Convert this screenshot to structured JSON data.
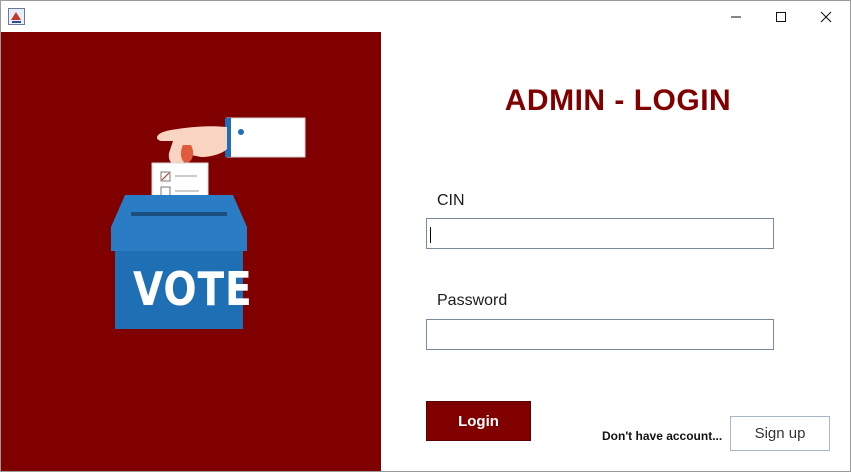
{
  "window": {
    "icon": "java-app-icon",
    "controls": [
      "minimize-icon",
      "maximize-icon",
      "close-icon"
    ]
  },
  "illustration": {
    "text": "VOTE",
    "colors": {
      "background": "#800000",
      "box": "#1f6fb5",
      "box_lid": "#2a7dc4"
    }
  },
  "login": {
    "title": "ADMIN - LOGIN",
    "cin_label": "CIN",
    "cin_value": "",
    "password_label": "Password",
    "password_value": "",
    "login_button": "Login",
    "no_account_text": "Don't have account...",
    "signup_button": "Sign up"
  },
  "colors": {
    "accent": "#800000"
  }
}
